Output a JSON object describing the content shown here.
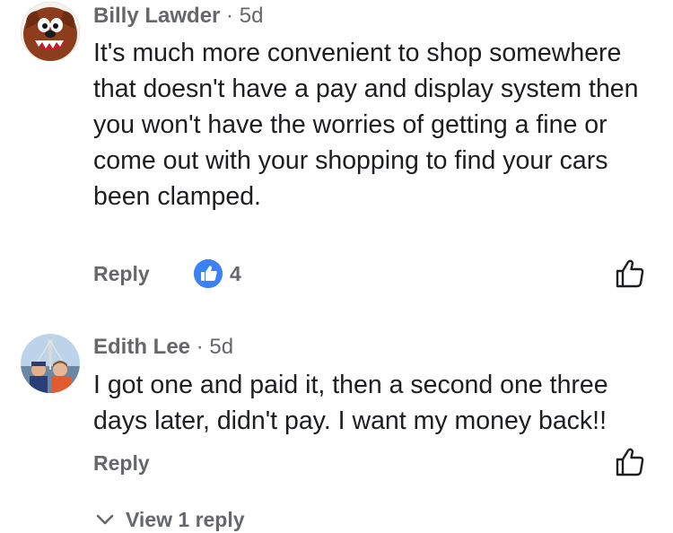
{
  "comments": [
    {
      "author": "Billy Lawder",
      "separator": "·",
      "time": "5d",
      "text": "It's much more convenient to shop somewhere that doesn't have a pay and display system then you won't have the worries of getting a fine or come out with your shopping to find your cars been clamped.",
      "reply_label": "Reply",
      "reaction": {
        "icon": "thumbs-up-icon",
        "count": "4"
      },
      "like_icon": "thumbs-up-outline-icon"
    },
    {
      "author": "Edith Lee",
      "separator": "·",
      "time": "5d",
      "text": "I got one and paid it, then a second one three days later, didn't pay. I want my money back!!",
      "reply_label": "Reply",
      "like_icon": "thumbs-up-outline-icon"
    }
  ],
  "view_replies": {
    "icon": "chevron-down-icon",
    "label": "View 1 reply"
  },
  "colors": {
    "meta_text": "#65676b",
    "body_text": "#1c1e21",
    "reaction_blue": "#3b82f6",
    "background": "#ffffff"
  }
}
